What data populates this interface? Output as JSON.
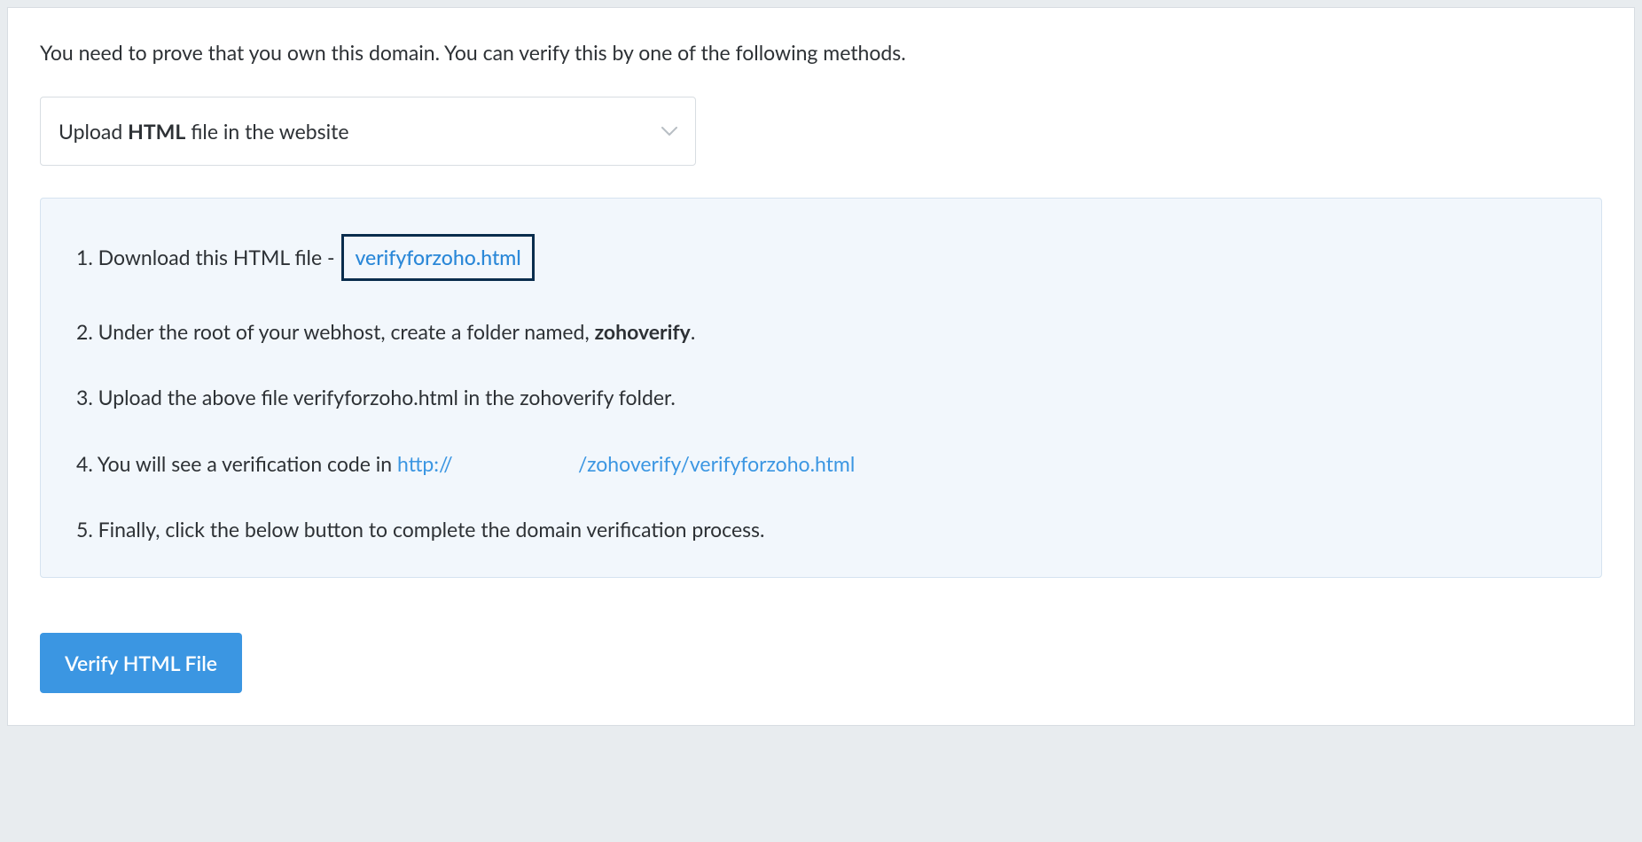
{
  "intro": "You need to prove that you own this domain. You can verify this by one of the following methods.",
  "methodSelect": {
    "labelPrefix": "Upload ",
    "labelBold": "HTML",
    "labelSuffix": " file in the website"
  },
  "steps": {
    "step1": {
      "text": "1. Download this HTML file -",
      "filename": "verifyforzoho.html"
    },
    "step2": {
      "prefix": "2. Under the root of your webhost, create a folder named, ",
      "boldText": "zohoverify",
      "suffix": "."
    },
    "step3": "3. Upload the above file verifyforzoho.html in the zohoverify folder.",
    "step4": {
      "prefix": "4. You will see a verification code in ",
      "urlStart": "http://",
      "urlEnd": "/zohoverify/verifyforzoho.html"
    },
    "step5": "5. Finally, click the below button to complete the domain verification process."
  },
  "verifyButton": "Verify HTML File"
}
